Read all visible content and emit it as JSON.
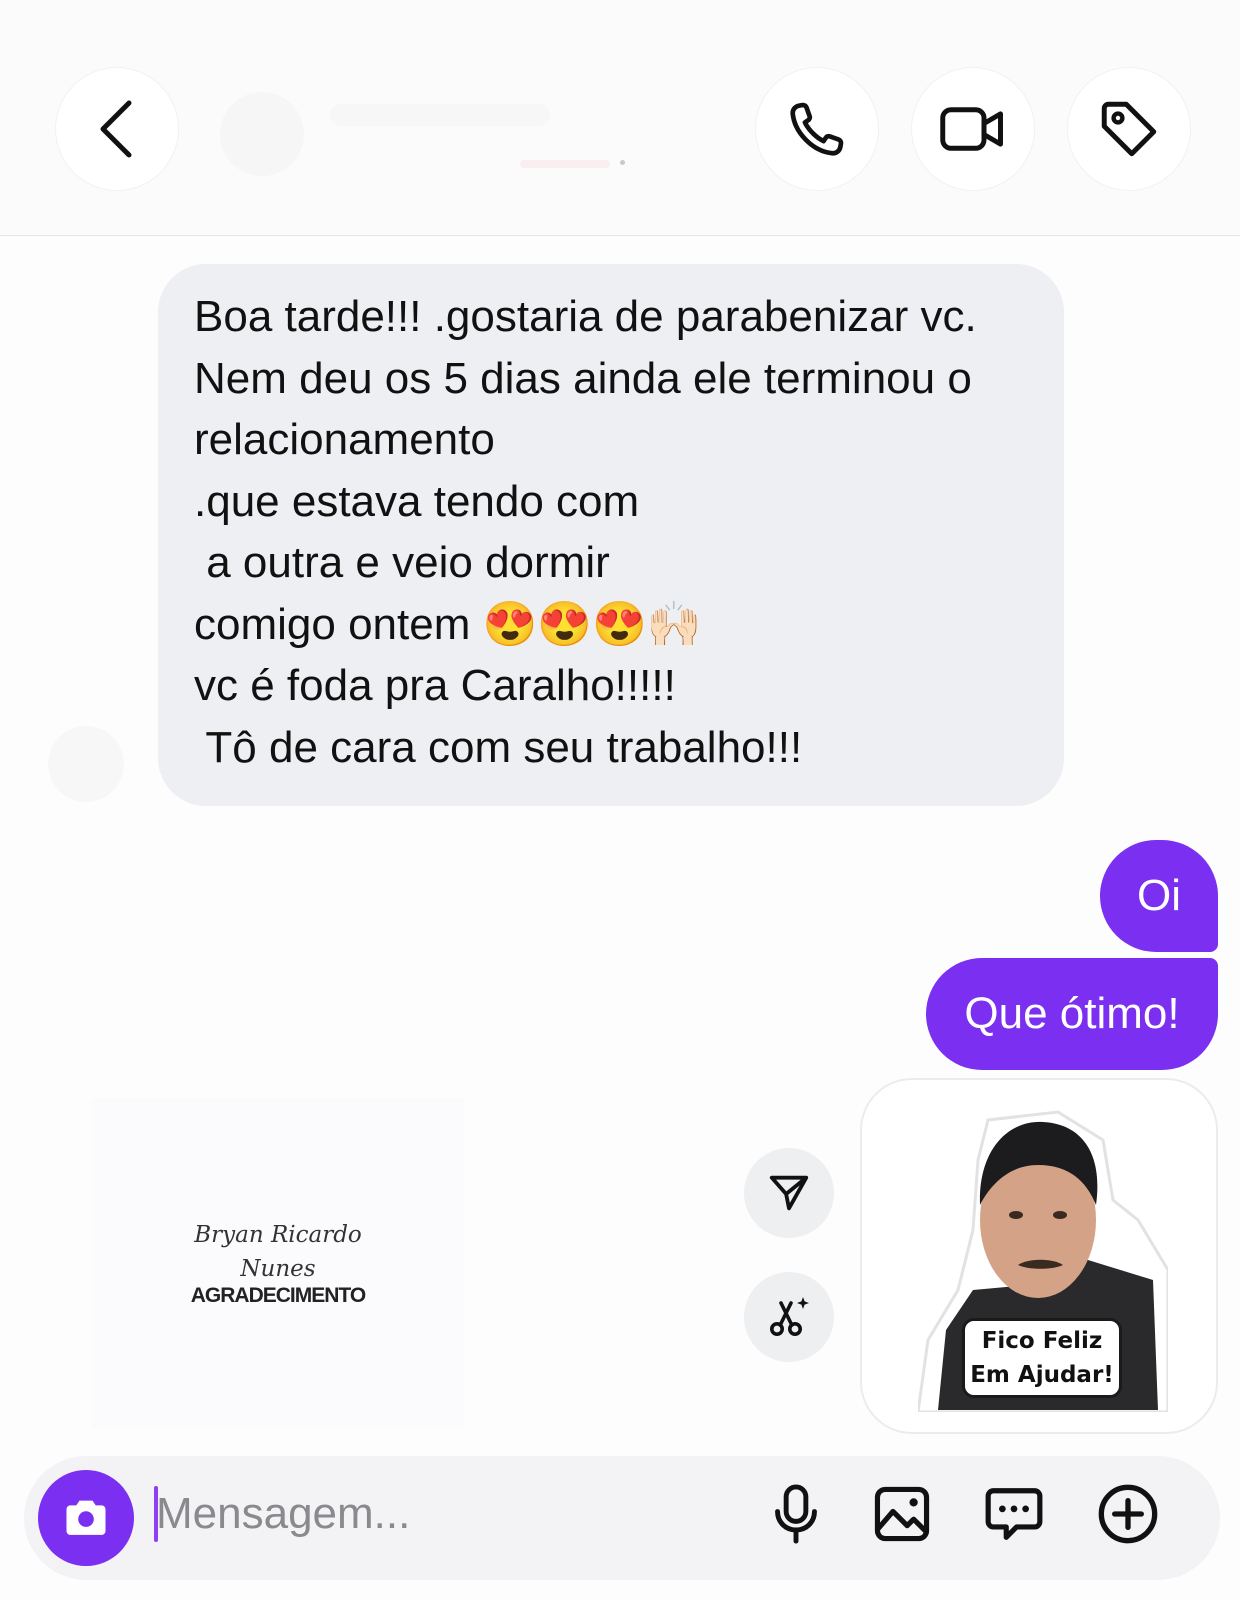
{
  "header": {
    "back_icon": "chevron-left-icon",
    "actions": [
      "phone-icon",
      "video-camera-icon",
      "tag-icon"
    ]
  },
  "received": {
    "lines": [
      "Boa tarde!!! .gostaria de parabenizar vc.",
      "Nem deu os 5 dias ainda ele terminou o",
      "relacionamento",
      ".que estava tendo com",
      " a outra e veio dormir",
      "comigo ontem 😍😍😍🙌🏻",
      "vc é foda pra Caralho!!!!!",
      " Tô de cara com seu trabalho!!!"
    ]
  },
  "sent": {
    "msg1": "Oi",
    "msg2": "Que ótimo!"
  },
  "sticker": {
    "caption_line1": "Fico Feliz",
    "caption_line2": "Em Ajudar!"
  },
  "watermark": {
    "name_line1": "Bryan Ricardo",
    "name_line2": "Nunes",
    "title": "AGRADECIMENTO"
  },
  "composer": {
    "placeholder": "Mensagem...",
    "icons": [
      "camera-icon",
      "microphone-icon",
      "image-icon",
      "chat-options-icon",
      "plus-circle-icon"
    ]
  },
  "colors": {
    "accent": "#7b2ff0",
    "received_bubble": "#eeeff2",
    "background": "#fdfdfe"
  }
}
